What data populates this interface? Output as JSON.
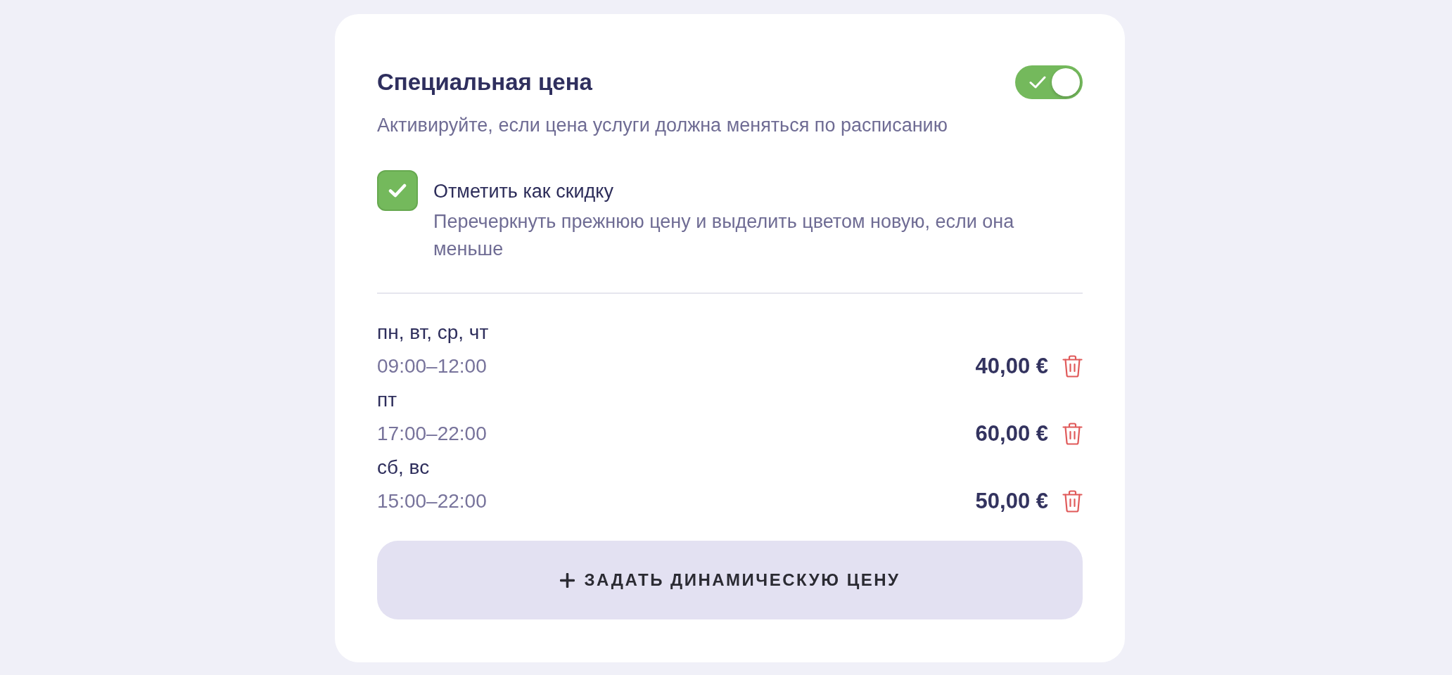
{
  "special_price": {
    "title": "Специальная цена",
    "enabled": true,
    "description": "Активируйте, если цена услуги должна меняться по расписанию"
  },
  "discount_option": {
    "label": "Отметить как скидку",
    "checked": true,
    "description": "Перечеркнуть прежнюю цену и выделить цветом новую, если она меньше"
  },
  "schedule": [
    {
      "days": "пн, вт, ср, чт",
      "time": "09:00–12:00",
      "price": "40,00 €"
    },
    {
      "days": "пт",
      "time": "17:00–22:00",
      "price": "60,00 €"
    },
    {
      "days": "сб, вс",
      "time": "15:00–22:00",
      "price": "50,00 €"
    }
  ],
  "add_button": {
    "label": "ЗАДАТЬ ДИНАМИЧЕСКУЮ ЦЕНУ"
  }
}
